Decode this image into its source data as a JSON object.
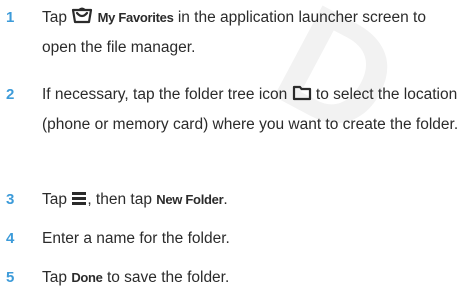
{
  "watermark": "D",
  "steps": [
    {
      "number": "1",
      "pre": "Tap",
      "icon": "favorites-bag-icon",
      "bold": "My Favorites",
      "post": "in the application launcher screen to open the file manager."
    },
    {
      "number": "2",
      "pre": "If necessary, tap the folder tree icon",
      "icon": "folder-icon",
      "post": "to select the location (phone or memory card) where you want to create the folder."
    },
    {
      "number": "3",
      "pre": "Tap",
      "icon": "menu-icon",
      "mid": ", then tap",
      "bold": "New Folder",
      "post": "."
    },
    {
      "number": "4",
      "text": "Enter a name for the folder."
    },
    {
      "number": "5",
      "pre": "Tap",
      "bold": "Done",
      "post": "to save the folder."
    }
  ],
  "colors": {
    "number": "#3d9bd9",
    "text": "#2b2b2b"
  }
}
